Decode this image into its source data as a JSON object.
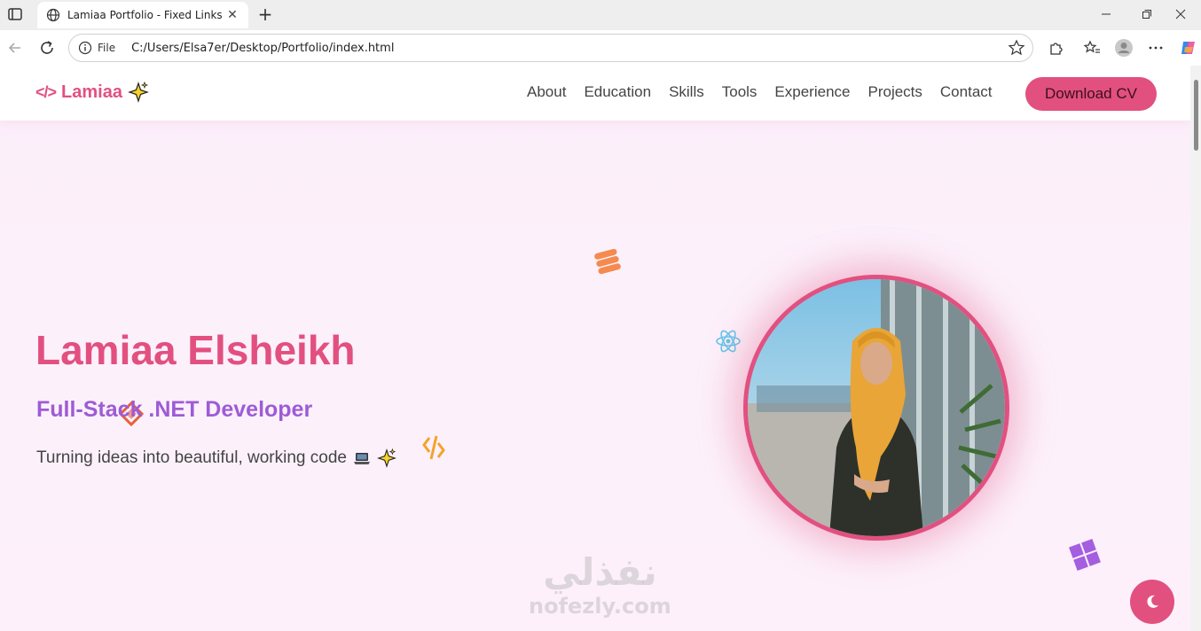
{
  "browser": {
    "tab_title": "Lamiaa Portfolio - Fixed Links",
    "scheme_label": "File",
    "url": "C:/Users/Elsa7er/Desktop/Portfolio/index.html"
  },
  "header": {
    "logo_text": "Lamiaa",
    "logo_symbol": "</>",
    "nav": [
      "About",
      "Education",
      "Skills",
      "Tools",
      "Experience",
      "Projects",
      "Contact"
    ],
    "cta_label": "Download CV"
  },
  "hero": {
    "name": "Lamiaa Elsheikh",
    "role": "Full-Stack .NET Developer",
    "tagline": "Turning ideas into beautiful, working code"
  },
  "watermark": {
    "arabic": "نفذلي",
    "latin": "nofezly.com"
  },
  "colors": {
    "accent": "#e2507f",
    "role": "#9e5bd6",
    "background": "#fbeefa"
  },
  "icons": [
    "globe-icon",
    "close-icon",
    "plus-icon",
    "back-icon",
    "reload-icon",
    "info-icon",
    "star-icon",
    "extensions-icon",
    "favorites-icon",
    "profile-icon",
    "more-icon",
    "copilot-icon",
    "sparkles-icon",
    "laptop-icon",
    "moon-icon",
    "database-icon",
    "react-icon",
    "windows-icon",
    "code-icon",
    "diamond-icon"
  ]
}
